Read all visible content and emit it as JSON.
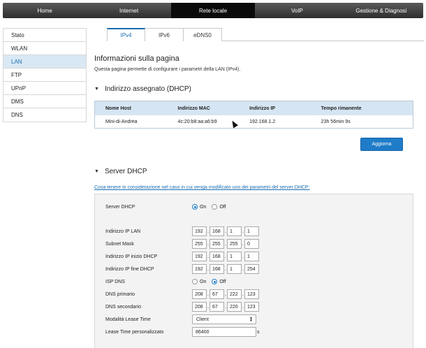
{
  "topnav": {
    "items": [
      {
        "label": "Home",
        "active": false
      },
      {
        "label": "Internet",
        "active": false
      },
      {
        "label": "Rete locale",
        "active": true
      },
      {
        "label": "VoIP",
        "active": false
      },
      {
        "label": "Gestione & Diagnosi",
        "active": false
      }
    ]
  },
  "sidebar": {
    "items": [
      {
        "label": "Stato",
        "active": false
      },
      {
        "label": "WLAN",
        "active": false
      },
      {
        "label": "LAN",
        "active": true
      },
      {
        "label": "FTP",
        "active": false
      },
      {
        "label": "UPnP",
        "active": false
      },
      {
        "label": "DMS",
        "active": false
      },
      {
        "label": "DNS",
        "active": false
      }
    ]
  },
  "tabs": [
    {
      "label": "IPv4",
      "active": true
    },
    {
      "label": "IPv6",
      "active": false
    },
    {
      "label": "eDNS0",
      "active": false
    }
  ],
  "page": {
    "title": "Informazioni sulla pagina",
    "description": "Questa pagina permette di configurare i parametri della LAN (IPv4)."
  },
  "dhcp_assigned": {
    "heading": "Indirizzo assegnato (DHCP)",
    "columns": [
      "Nome Host",
      "Indirizzo MAC",
      "Indirizzo IP",
      "Tempo rimanente"
    ],
    "rows": [
      [
        "Mini-di-Andrea",
        "4c:20:b8:aa:a6:b9",
        "192.168.1.2",
        "23h 56min 9s"
      ]
    ],
    "refresh_label": "Aggiorna"
  },
  "dhcp_server": {
    "heading": "Server DHCP",
    "link": "Cosa tenere in considerazione nel caso in cui venga modificato uno dei parametri del server DHCP:",
    "server_label": "Server DHCP",
    "on_label": "On",
    "off_label": "Off",
    "server_state": "on",
    "lan_ip_label": "Indirizzo IP LAN",
    "lan_ip": [
      "192",
      "168",
      "1",
      "1"
    ],
    "subnet_label": "Subnet Mask",
    "subnet": [
      "255",
      "255",
      "255",
      "0"
    ],
    "start_label": "Indirizzo IP inizio DHCP",
    "start_ip": [
      "192",
      "168",
      "1",
      "1"
    ],
    "end_label": "Indirizzo IP fine DHCP",
    "end_ip": [
      "192",
      "168",
      "1",
      "254"
    ],
    "isp_dns_label": "ISP DNS",
    "isp_dns_state": "off",
    "dns1_label": "DNS primario",
    "dns1": [
      "208",
      "67",
      "222",
      "123"
    ],
    "dns2_label": "DNS secondario",
    "dns2": [
      "208",
      "67",
      "220",
      "123"
    ],
    "lease_mode_label": "Modalità Lease Time",
    "lease_mode_value": "Client",
    "lease_custom_label": "Lease Time personalizzato",
    "lease_custom_value": "86400",
    "lease_unit": "s"
  }
}
